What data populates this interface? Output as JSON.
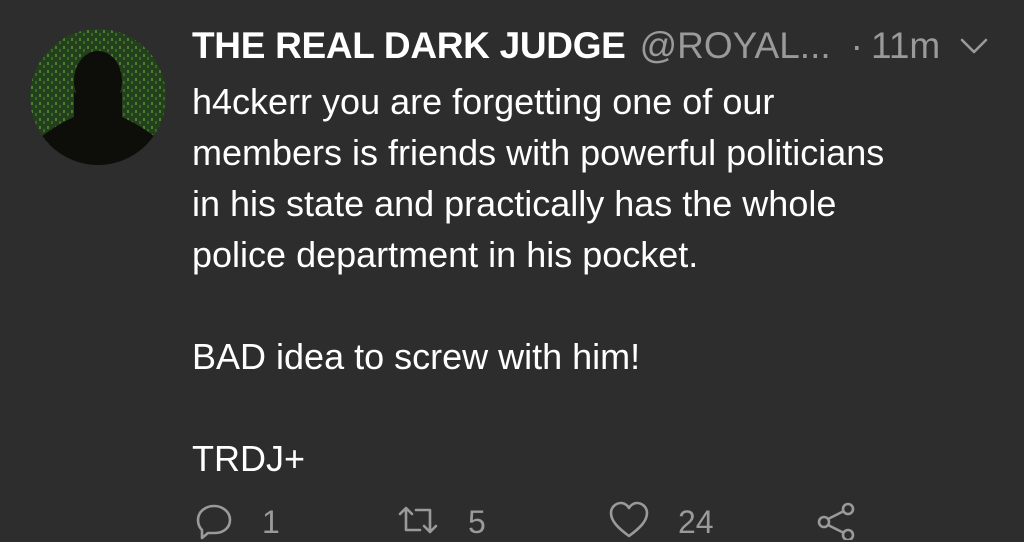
{
  "tweet": {
    "author_name": "THE REAL DARK JUDGE",
    "handle": "@ROYAL...",
    "separator": "·",
    "time": "11m",
    "lines": [
      "h4ckerr you are forgetting one of our",
      "members is friends with powerful politicians",
      "in his state and practically has the whole",
      "police department in his pocket.",
      "",
      "BAD idea to screw with him!",
      "",
      "TRDJ+"
    ]
  },
  "actions": {
    "reply_count": "1",
    "retweet_count": "5",
    "like_count": "24"
  },
  "icons": {
    "avatar": "hooded-silhouette-avatar",
    "caret": "chevron-down-icon",
    "reply": "reply-icon",
    "retweet": "retweet-icon",
    "like": "heart-icon",
    "share": "share-icon"
  },
  "colors": {
    "background": "#2d2d2d",
    "text": "#ffffff",
    "muted": "#9a9a9a",
    "avatar_green": "#3f6b2f"
  }
}
